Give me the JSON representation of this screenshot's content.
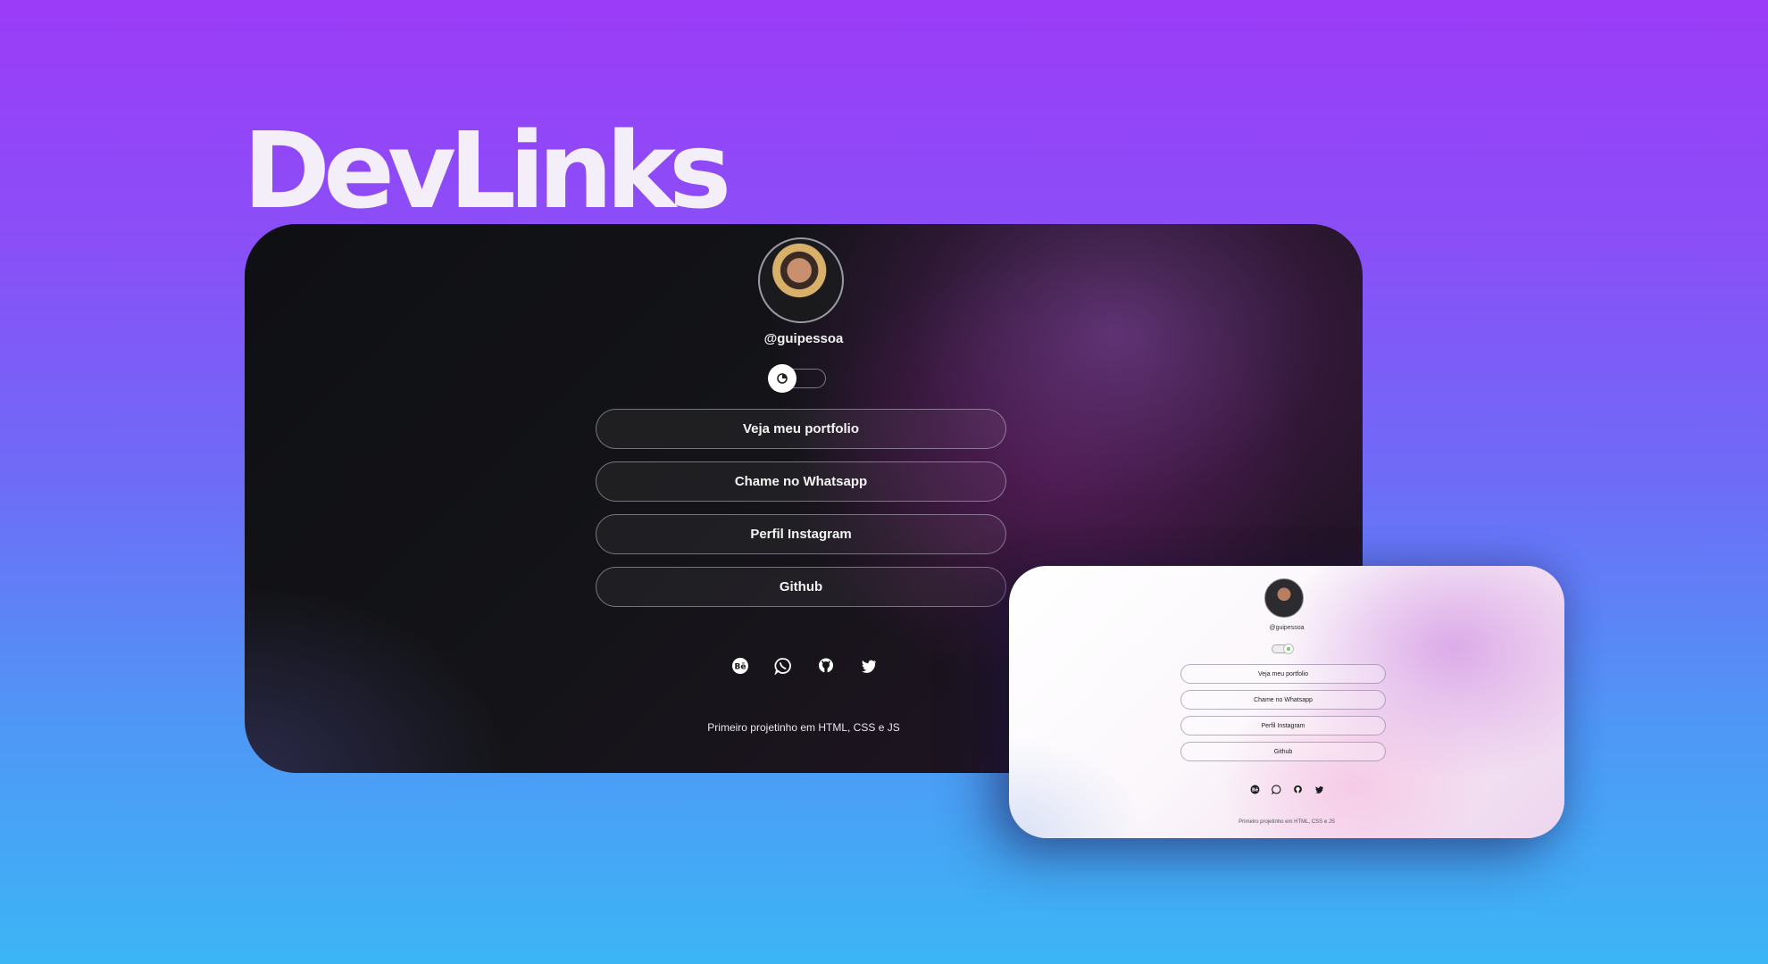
{
  "brand": {
    "title": "DevLinks"
  },
  "dark_preview": {
    "username": "@guipessoa",
    "theme_toggle_icon": "moon-icon",
    "links": [
      "Veja meu portfolio",
      "Chame no Whatsapp",
      "Perfil Instagram",
      "Github"
    ],
    "socials": [
      "behance-icon",
      "whatsapp-icon",
      "github-icon",
      "twitter-icon"
    ],
    "footer": "Primeiro projetinho em HTML, CSS e JS"
  },
  "light_preview": {
    "username": "@guipessoa",
    "links": [
      "Veja meu portfolio",
      "Chame no Whatsapp",
      "Perfil Instagram",
      "Github"
    ],
    "socials": [
      "behance-icon",
      "whatsapp-icon",
      "github-icon",
      "twitter-icon"
    ],
    "footer": "Primeiro projetinho em HTML, CSS e JS"
  },
  "colors": {
    "background_top": "#9b3cf8",
    "background_bottom": "#3cb5f5",
    "dark_card": "#121215",
    "light_card": "#ffffff"
  }
}
